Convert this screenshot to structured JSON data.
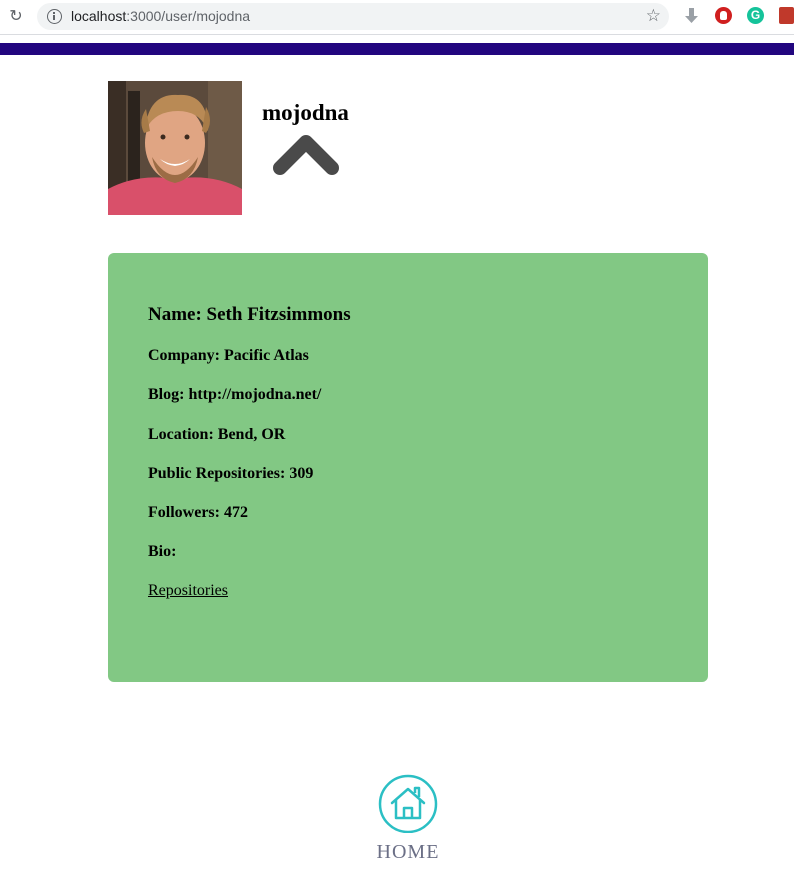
{
  "browser": {
    "url_host": "localhost",
    "url_path": ":3000/user/mojodna",
    "reload_icon": "reload-icon",
    "info_icon": "info-icon",
    "star_icon": "star-icon",
    "extensions": [
      "download-icon",
      "adblock-icon",
      "grammarly-icon",
      "extension-icon"
    ],
    "grammarly_glyph": "G"
  },
  "header": {
    "avatar_alt": "avatar",
    "username": "mojodna",
    "toggle_icon": "chevron-up-icon"
  },
  "profile": {
    "name": "Name: Seth Fitzsimmons",
    "company": "Company: Pacific Atlas",
    "blog": "Blog: http://mojodna.net/",
    "location": "Location: Bend, OR",
    "public_repos": "Public Repositories: 309",
    "followers": "Followers: 472",
    "bio": "Bio:",
    "repositories_link": "Repositories"
  },
  "footer": {
    "home_icon": "home-icon",
    "home_label": "HOME"
  },
  "colors": {
    "top_bar": "#22067f",
    "card": "#82c884",
    "home_icon": "#2bbfc4",
    "chevron": "#4a4a4a"
  }
}
